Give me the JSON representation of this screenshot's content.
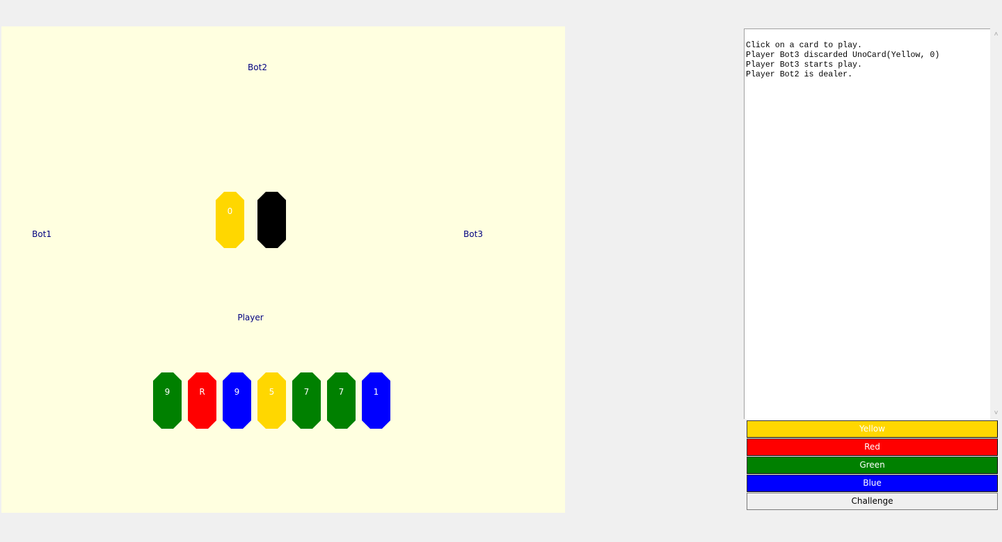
{
  "table": {
    "players": {
      "top": "Bot2",
      "left": "Bot1",
      "right": "Bot3",
      "bottom": "Player"
    },
    "discard_pile": {
      "label": "0",
      "color": "#FFD700"
    },
    "draw_pile": {
      "label": "",
      "color": "#000000"
    },
    "hand": [
      {
        "label": "9",
        "color": "#008000"
      },
      {
        "label": "R",
        "color": "#FF0000"
      },
      {
        "label": "9",
        "color": "#0000FF"
      },
      {
        "label": "5",
        "color": "#FFD700"
      },
      {
        "label": "7",
        "color": "#008000"
      },
      {
        "label": "7",
        "color": "#008000"
      },
      {
        "label": "1",
        "color": "#0000FF"
      }
    ]
  },
  "log": {
    "lines": [
      "Click on a card to play.",
      "Player Bot3 discarded UnoCard(Yellow, 0)",
      "Player Bot3 starts play.",
      "Player Bot2 is dealer."
    ]
  },
  "scrollbar": {
    "up_icon": "chevron-up-icon",
    "down_icon": "chevron-down-icon"
  },
  "color_buttons": [
    {
      "label": "Yellow",
      "color": "#FFD700",
      "text_color": "#FFFFFF"
    },
    {
      "label": "Red",
      "color": "#FF0000",
      "text_color": "#FFFFFF"
    },
    {
      "label": "Green",
      "color": "#008000",
      "text_color": "#FFFFFF"
    },
    {
      "label": "Blue",
      "color": "#0000FF",
      "text_color": "#FFFFFF"
    },
    {
      "label": "Challenge",
      "color": "#F0F0F0",
      "text_color": "#000000"
    }
  ]
}
